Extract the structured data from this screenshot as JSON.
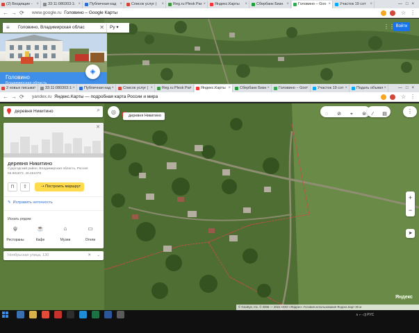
{
  "window1": {
    "tabs": [
      {
        "label": "(2) Входящие -",
        "color": "#d44638"
      },
      {
        "label": "33:11:080303:1:",
        "color": "#888888"
      },
      {
        "label": "Публичная кад",
        "color": "#2b6fd6"
      },
      {
        "label": "Список услуг |",
        "color": "#d44638"
      },
      {
        "label": "Reg.ru Plesk Par",
        "color": "#3b9a3b"
      },
      {
        "label": "Яндекс.Карты",
        "color": "#ff3333"
      },
      {
        "label": "Сбербанк Бизн",
        "color": "#21a038"
      },
      {
        "label": "Головино – Goo",
        "color": "#34a853"
      },
      {
        "label": "Участок 19 сот",
        "color": "#00aaff"
      }
    ],
    "url_host": "www.google.ru",
    "url_title": "Головино – Google Карты",
    "search_query": "Головино, Владимирская облас",
    "lang_select": "Ру",
    "place_name": "Головино",
    "place_sub": "Владимирская область",
    "signin_label": "Войти"
  },
  "window2": {
    "tabs": [
      {
        "label": "2 новых письма",
        "color": "#d44638"
      },
      {
        "label": "33:11:080303:1:",
        "color": "#888888"
      },
      {
        "label": "Публичная кад",
        "color": "#2b6fd6"
      },
      {
        "label": "Список услуг |",
        "color": "#d44638"
      },
      {
        "label": "Reg.ru Plesk Par",
        "color": "#3b9a3b"
      },
      {
        "label": "Яндекс.Карты",
        "color": "#ff3333"
      },
      {
        "label": "Сбербанк Бизн",
        "color": "#21a038"
      },
      {
        "label": "Головино – Goo",
        "color": "#34a853"
      },
      {
        "label": "Участок 19 сот",
        "color": "#00aaff"
      },
      {
        "label": "Подать объявл",
        "color": "#00aaff"
      }
    ],
    "url_host": "yandex.ru",
    "url_title": "Яндекс.Карты — подробная карта России и мира",
    "search_query": "деревня Никитино",
    "place_title": "деревня Никитино",
    "place_sub": "Судогодский район, Владимирская область, Россия",
    "coords": "55.981872, 40.451078",
    "route_label": "Построить маршрут",
    "fix_label": "Исправить неточность",
    "nearby_label": "Искать рядом:",
    "categories": [
      {
        "label": "Рестораны",
        "icon": "fork-knife-icon"
      },
      {
        "label": "Кафе",
        "icon": "cup-icon"
      },
      {
        "label": "Музеи",
        "icon": "museum-icon"
      },
      {
        "label": "Отели",
        "icon": "bed-icon"
      }
    ],
    "address_placeholder": "Ноябрьская улица, 130",
    "pin_label": "деревня Никитино",
    "logo": "Яндекс",
    "copyright": "© GeoEye, Inc. © 2006 — 2021 ООО «Яндекс» Условия использования Яндекс.Карт 30 м"
  },
  "taskbar": {
    "tray": "∧  ⌐  ◁)  РУС",
    "time": "",
    "date": ""
  },
  "colors": {
    "yandex_yellow": "#ffdb4d",
    "google_blue": "#1a73e8",
    "plot_boundary": "#c94a4a"
  }
}
